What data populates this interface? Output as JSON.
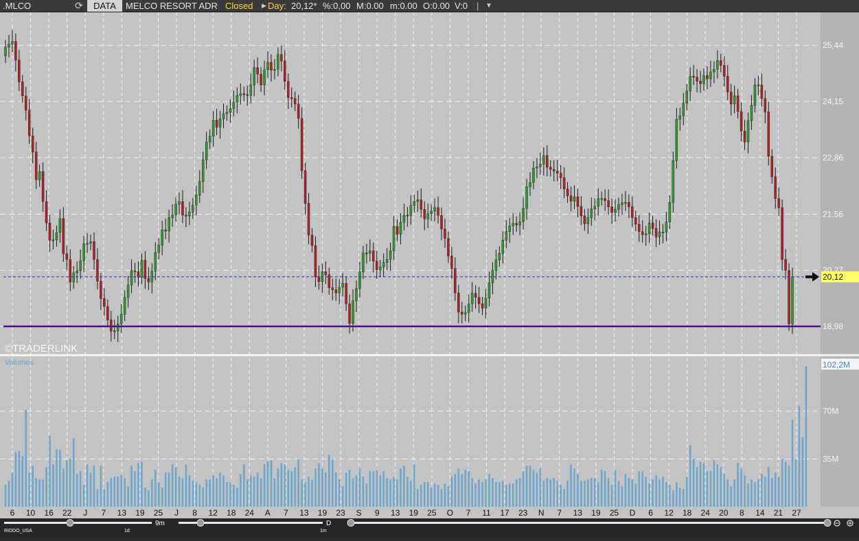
{
  "toolbar": {
    "symbol": ".MLCO",
    "data_tab": "DATA",
    "instrument_name": "MELCO RESORT  ADR",
    "market_status": "Closed",
    "period_label": "Day:",
    "last_price": "20,12*",
    "pct_change": "%:0,00",
    "M": "M:0.00",
    "m": "m:0.00",
    "O": "O:0.00",
    "V": "V:0",
    "separator": "|"
  },
  "colors": {
    "up_candle": "#2e9a2e",
    "down_candle": "#b22222",
    "volume_bar": "#6aa6cf",
    "support_line": "#4b0f8e",
    "price_line": "#2a2ad8",
    "price_tag": "#ffff66"
  },
  "watermark": "©TRADERLINK",
  "scroll": {
    "left_label": "RIDDO_USA",
    "zoom_label": "9m",
    "left_tick_1": "1d",
    "left_tick_2": "1m",
    "period": "D"
  },
  "chart_data": [
    {
      "type": "candlestick",
      "name_label": "",
      "yticks": [
        "25,44",
        "24,15",
        "22,86",
        "21,56",
        "20,27",
        "18,98"
      ],
      "ylim": [
        18.35,
        26.2
      ],
      "current_price": 20.12,
      "current_price_label": "20,12",
      "support_level": 18.98,
      "xticks": [
        "6",
        "10",
        "16",
        "22",
        "J",
        "7",
        "13",
        "19",
        "25",
        "J",
        "8",
        "12",
        "18",
        "24",
        "A",
        "7",
        "13",
        "19",
        "23",
        "S",
        "9",
        "13",
        "19",
        "25",
        "O",
        "7",
        "11",
        "17",
        "23",
        "N",
        "7",
        "13",
        "19",
        "25",
        "D",
        "6",
        "12",
        "18",
        "24",
        "20",
        "8",
        "14",
        "21",
        "27"
      ],
      "close": [
        25.4,
        25.47,
        25.53,
        25.1,
        24.6,
        24.28,
        23.95,
        23.36,
        22.99,
        22.35,
        22.54,
        21.85,
        21.36,
        20.96,
        20.97,
        21.14,
        21.46,
        20.65,
        20.52,
        20.0,
        20.21,
        20.26,
        20.49,
        20.88,
        20.89,
        20.93,
        20.52,
        20.02,
        19.62,
        19.44,
        19.13,
        18.87,
        18.88,
        19.04,
        19.26,
        19.65,
        19.93,
        20.26,
        20.24,
        20.11,
        20.5,
        20.08,
        20.0,
        20.25,
        20.68,
        20.85,
        21.2,
        21.17,
        21.48,
        21.55,
        21.79,
        21.85,
        21.54,
        21.52,
        21.61,
        21.77,
        22.0,
        22.31,
        22.81,
        23.22,
        23.35,
        23.72,
        23.56,
        23.75,
        23.87,
        23.9,
        23.99,
        24.14,
        24.29,
        24.33,
        24.31,
        24.29,
        24.53,
        24.93,
        24.78,
        24.53,
        24.88,
        25.05,
        24.87,
        24.89,
        25.23,
        25.08,
        24.61,
        24.24,
        24.22,
        24.09,
        23.76,
        22.56,
        21.81,
        21.08,
        20.84,
        20.12,
        20.01,
        20.24,
        20.17,
        19.87,
        19.82,
        19.75,
        19.88,
        19.97,
        19.5,
        19.05,
        19.57,
        19.85,
        20.23,
        20.67,
        20.66,
        20.72,
        20.48,
        20.28,
        20.35,
        20.45,
        20.52,
        20.72,
        21.28,
        21.1,
        21.37,
        21.54,
        21.53,
        21.76,
        21.85,
        21.89,
        21.67,
        21.45,
        21.57,
        21.63,
        21.71,
        21.53,
        21.22,
        21.0,
        20.6,
        20.31,
        19.75,
        19.31,
        19.26,
        19.3,
        19.5,
        19.74,
        19.65,
        19.5,
        19.4,
        19.63,
        19.98,
        20.27,
        20.51,
        20.66,
        20.96,
        21.16,
        21.29,
        21.35,
        21.31,
        21.39,
        21.69,
        22.19,
        22.29,
        22.62,
        22.65,
        22.71,
        22.91,
        22.64,
        22.59,
        22.55,
        22.5,
        22.4,
        22.14,
        21.98,
        21.86,
        21.96,
        21.74,
        21.52,
        21.34,
        21.48,
        21.68,
        21.74,
        21.92,
        21.92,
        21.87,
        21.73,
        21.6,
        21.67,
        21.78,
        21.82,
        21.83,
        21.73,
        21.48,
        21.33,
        21.16,
        21.09,
        21.11,
        21.36,
        21.23,
        21.04,
        21.15,
        21.15,
        21.38,
        21.83,
        22.79,
        23.74,
        23.82,
        24.11,
        24.39,
        24.73,
        24.71,
        24.62,
        24.56,
        24.75,
        24.67,
        24.83,
        24.89,
        25.09,
        24.98,
        24.73,
        24.37,
        24.09,
        24.28,
        23.92,
        23.47,
        23.22,
        23.71,
        24.06,
        24.53,
        24.53,
        24.22,
        23.91,
        22.89,
        22.42,
        21.92,
        21.71,
        20.52,
        20.27,
        19.04,
        20.12
      ],
      "volume": [
        16,
        19,
        25,
        40,
        41,
        37,
        71,
        25,
        30,
        21,
        20,
        20,
        29,
        52,
        31,
        42,
        42,
        28,
        34,
        35,
        50,
        24,
        26,
        16,
        31,
        25,
        30,
        13,
        30,
        13,
        18,
        21,
        22,
        22,
        23,
        21,
        15,
        30,
        26,
        32,
        33,
        14,
        12,
        20,
        27,
        18,
        14,
        25,
        25,
        31,
        29,
        22,
        21,
        31,
        23,
        19,
        18,
        16,
        14,
        20,
        20,
        23,
        21,
        25,
        23,
        18,
        18,
        16,
        14,
        24,
        31,
        20,
        23,
        22,
        25,
        21,
        31,
        33,
        34,
        21,
        28,
        32,
        31,
        27,
        26,
        29,
        35,
        20,
        18,
        22,
        20,
        28,
        32,
        28,
        25,
        38,
        35,
        25,
        20,
        15,
        25,
        27,
        21,
        23,
        28,
        22,
        17,
        26,
        26,
        27,
        23,
        26,
        21,
        20,
        22,
        20,
        28,
        30,
        22,
        19,
        31,
        13,
        16,
        18,
        18,
        14,
        17,
        16,
        13,
        17,
        15,
        22,
        24,
        28,
        24,
        27,
        26,
        21,
        17,
        20,
        18,
        20,
        24,
        21,
        18,
        18,
        19,
        16,
        17,
        17,
        20,
        21,
        26,
        30,
        30,
        27,
        25,
        28,
        19,
        21,
        20,
        21,
        19,
        16,
        13,
        19,
        31,
        28,
        24,
        19,
        19,
        20,
        21,
        21,
        18,
        27,
        26,
        21,
        16,
        27,
        19,
        15,
        24,
        21,
        20,
        17,
        26,
        26,
        22,
        17,
        20,
        23,
        20,
        22,
        18,
        16,
        12,
        18,
        14,
        13,
        22,
        45,
        35,
        29,
        33,
        32,
        26,
        26,
        34,
        31,
        29,
        24,
        20,
        15,
        20,
        32,
        28,
        23,
        17,
        20,
        18,
        20,
        24,
        22,
        29,
        21,
        25,
        22,
        35,
        33,
        30,
        64,
        35,
        74,
        51,
        103
      ],
      "volume_yticks": [
        "35M",
        "70M"
      ],
      "volume_current_label": "102,2M",
      "volume_series_label": "Volumes",
      "volume_ylim": [
        0,
        108
      ]
    }
  ]
}
